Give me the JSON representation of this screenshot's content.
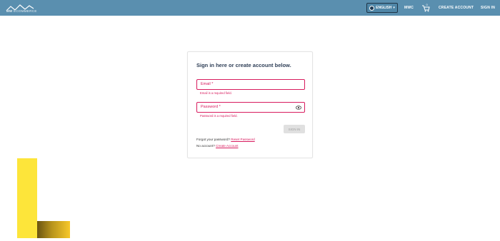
{
  "header": {
    "logo_text_bold": "MW",
    "logo_text_light": "ECOMMERCE",
    "language_label": "ENGLISH",
    "nav": {
      "mwc": "MWC",
      "create_account": "CREATE ACCOUNT",
      "sign_in": "SIGN IN"
    },
    "cart_count": "0",
    "colors": {
      "bar": "#5a8faf",
      "accent": "#d81b5e"
    }
  },
  "login": {
    "title": "Sign in here or create account below.",
    "email_label": "Email *",
    "email_error": "Email is a required field.",
    "password_label": "Password *",
    "password_error": "Password is a required field.",
    "signin_label": "SIGN IN",
    "forgot_text": "Forgot your password?",
    "reset_link": "Reset Password",
    "no_account_text": "No account?",
    "create_link": "Create Account"
  }
}
